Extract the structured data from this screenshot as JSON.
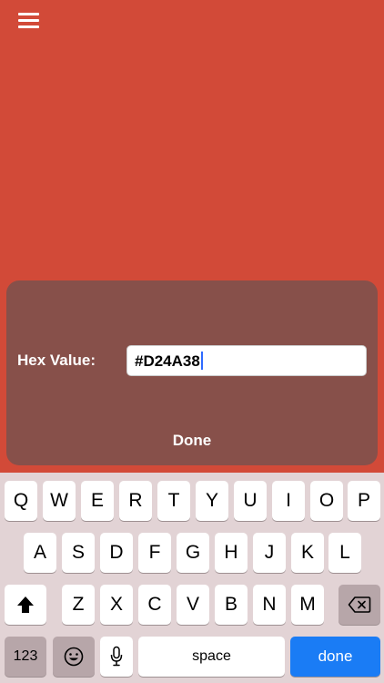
{
  "accent_color": "#D24A38",
  "panel": {
    "hex_label": "Hex Value:",
    "hex_value": "#D24A38",
    "done_label": "Done"
  },
  "keyboard": {
    "row1": [
      "Q",
      "W",
      "E",
      "R",
      "T",
      "Y",
      "U",
      "I",
      "O",
      "P"
    ],
    "row2": [
      "A",
      "S",
      "D",
      "F",
      "G",
      "H",
      "J",
      "K",
      "L"
    ],
    "row3": [
      "Z",
      "X",
      "C",
      "V",
      "B",
      "N",
      "M"
    ],
    "numbers_label": "123",
    "space_label": "space",
    "done_label": "done",
    "shift_icon": "shift-icon",
    "delete_icon": "delete-icon",
    "emoji_icon": "emoji-icon",
    "mic_icon": "microphone-icon"
  }
}
